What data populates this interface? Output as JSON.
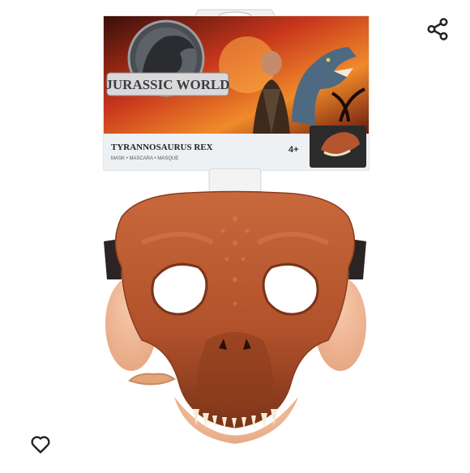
{
  "product": {
    "brand_logo_text": "JURASSIC WORLD",
    "name_line": "TYRANNOSAURUS REX",
    "sub_line": "MASK • MASCARA • MASQUE",
    "age_badge": "4+"
  },
  "actions": {
    "share_icon": "share-icon",
    "favorite_icon": "heart-icon"
  },
  "colors": {
    "mask_orange": "#b4552f",
    "mask_dark": "#7a3319",
    "skin": "#f0b795",
    "package_sky": "#e5602a"
  }
}
